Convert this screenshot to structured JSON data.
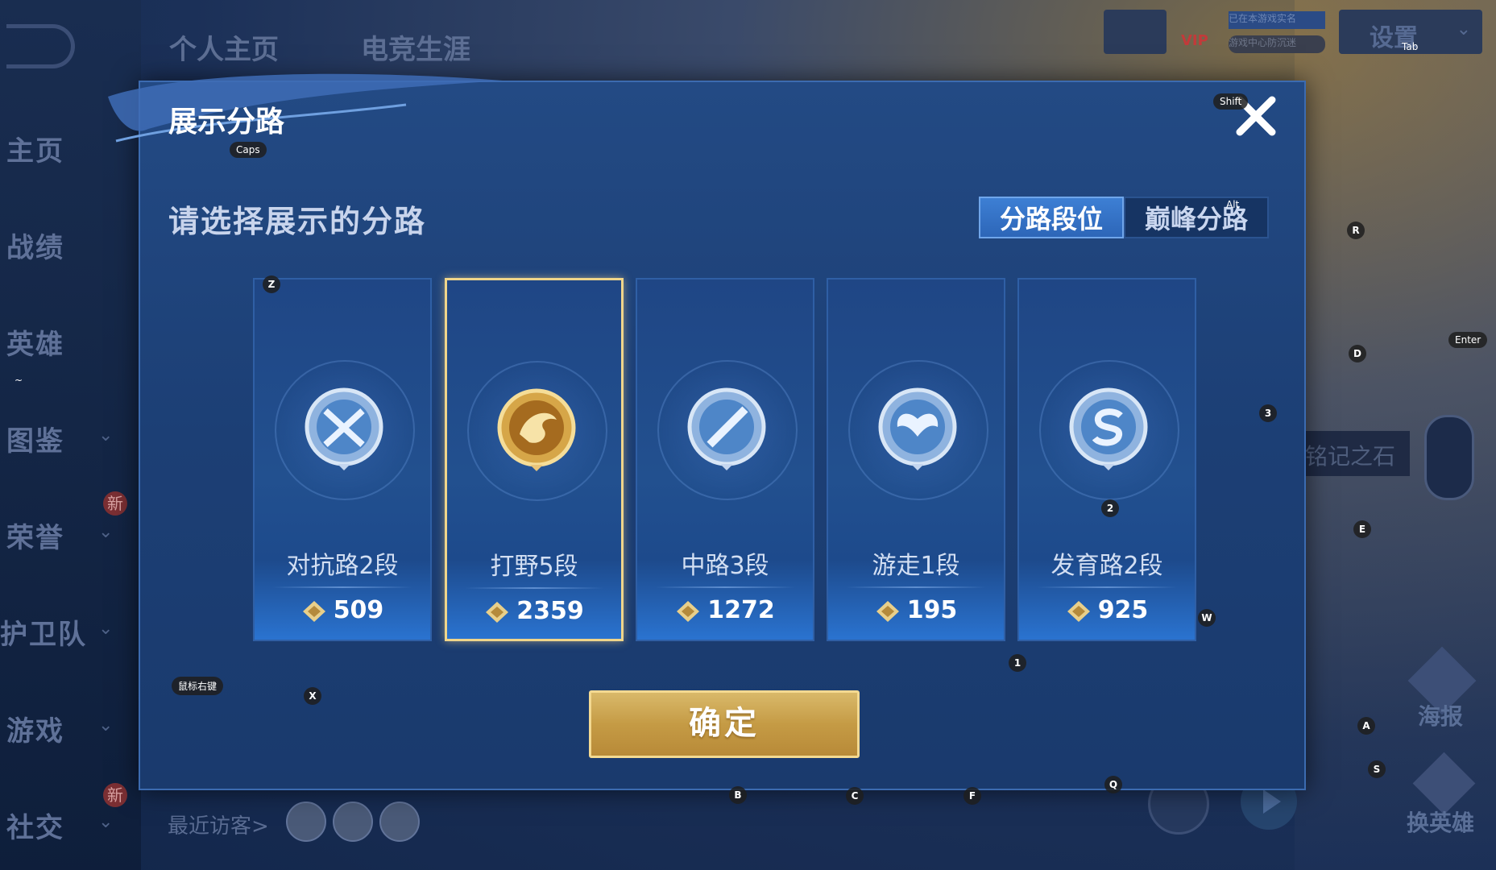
{
  "top_tabs": [
    "个人主页",
    "电竞生涯"
  ],
  "sidebar": [
    {
      "label": "主页",
      "has_caret": false,
      "new": false
    },
    {
      "label": "战绩",
      "has_caret": false,
      "new": false
    },
    {
      "label": "英雄",
      "has_caret": false,
      "new": false
    },
    {
      "label": "图鉴",
      "has_caret": true,
      "new": false
    },
    {
      "label": "荣誉",
      "has_caret": true,
      "new": true
    },
    {
      "label": "护卫队",
      "has_caret": true,
      "new": false
    },
    {
      "label": "游戏",
      "has_caret": true,
      "new": false
    },
    {
      "label": "社交",
      "has_caret": true,
      "new": true
    }
  ],
  "new_badge": "新",
  "topbar": {
    "settings": "设置",
    "vip": "VIP",
    "notice1": "已在本游戏实名",
    "notice2": "游戏中心防沉迷"
  },
  "right_panel": {
    "stone": "铭记之石",
    "poster": "海报",
    "change_hero": "换英雄"
  },
  "dialog": {
    "title": "展示分路",
    "subtitle": "请选择展示的分路",
    "segments": {
      "active": "分路段位",
      "inactive": "巅峰分路"
    },
    "confirm": "确定",
    "cards": [
      {
        "name": "对抗路2段",
        "score": "509",
        "emblem": "crossed-swords-emblem",
        "selected": false
      },
      {
        "name": "打野5段",
        "score": "2359",
        "emblem": "dragon-emblem",
        "selected": true
      },
      {
        "name": "中路3段",
        "score": "1272",
        "emblem": "slash-emblem",
        "selected": false
      },
      {
        "name": "游走1段",
        "score": "195",
        "emblem": "wings-emblem",
        "selected": false
      },
      {
        "name": "发育路2段",
        "score": "925",
        "emblem": "s-emblem",
        "selected": false
      }
    ]
  },
  "visitors_label": "最近访客>",
  "key_hints": {
    "caps": "Caps",
    "shift": "Shift",
    "alt": "Alt",
    "tab": "Tab",
    "enter": "Enter",
    "tilde": "~",
    "mouse_right": "鼠标右键",
    "z": "Z",
    "x": "X",
    "r": "R",
    "d": "D",
    "e": "E",
    "w": "W",
    "a": "A",
    "s": "S",
    "q": "Q",
    "b": "B",
    "c": "C",
    "f": "F",
    "n1": "1",
    "n2": "2",
    "n3": "3"
  },
  "colors": {
    "accent_gold": "#f0d58a",
    "active_segment": "#3d7fd4",
    "dialog_bg": "#1c3f75"
  }
}
